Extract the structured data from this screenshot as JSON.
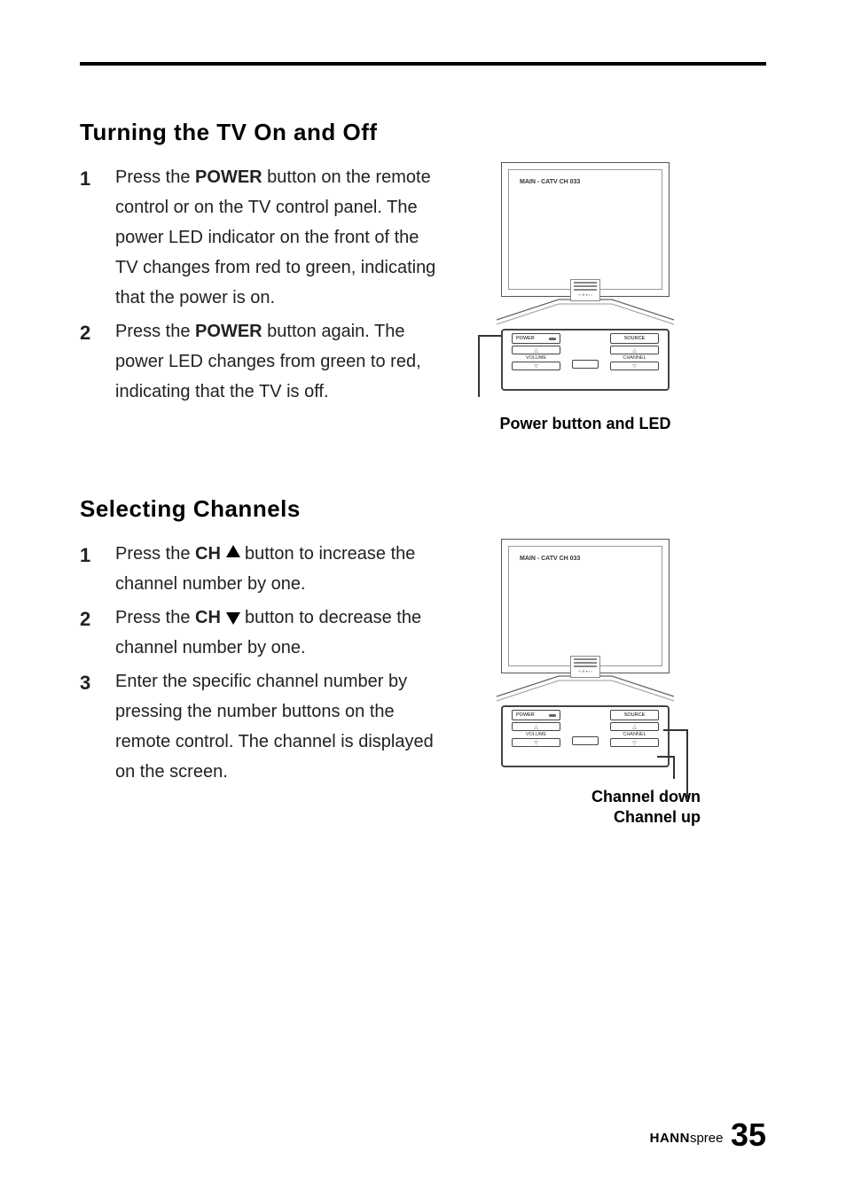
{
  "section1": {
    "heading": "Turning the TV On and Off",
    "steps": [
      {
        "num": "1",
        "pre": "Press the ",
        "bold": "POWER",
        "post": " button on the remote control or on the TV control panel. The power LED indicator on the front of the TV changes from red to green, indicating that the power is on."
      },
      {
        "num": "2",
        "pre": "Press the ",
        "bold": "POWER",
        "post": " button again. The power LED changes from green to red, indicating that the TV is off."
      }
    ],
    "caption": "Power button and LED"
  },
  "section2": {
    "heading": "Selecting Channels",
    "steps": [
      {
        "num": "1",
        "pre": "Press the ",
        "bold": "CH",
        "arrow": "up",
        "post": " button to increase the channel number by one."
      },
      {
        "num": "2",
        "pre": "Press the ",
        "bold": "CH",
        "arrow": "down",
        "post": " button to decrease the channel number by one."
      },
      {
        "num": "3",
        "pre": "Enter the specific channel number by pressing the number buttons on the remote control. The channel is displayed on the screen.",
        "bold": "",
        "post": ""
      }
    ],
    "caption1": "Channel down",
    "caption2": "Channel up"
  },
  "tv": {
    "osd": "MAIN - CATV CH 033",
    "power": "POWER",
    "source": "SOURCE",
    "volume": "VOLUME",
    "channel": "CHANNEL"
  },
  "footer": {
    "brand_bold": "HANN",
    "brand_light": "spree",
    "page": "35"
  }
}
